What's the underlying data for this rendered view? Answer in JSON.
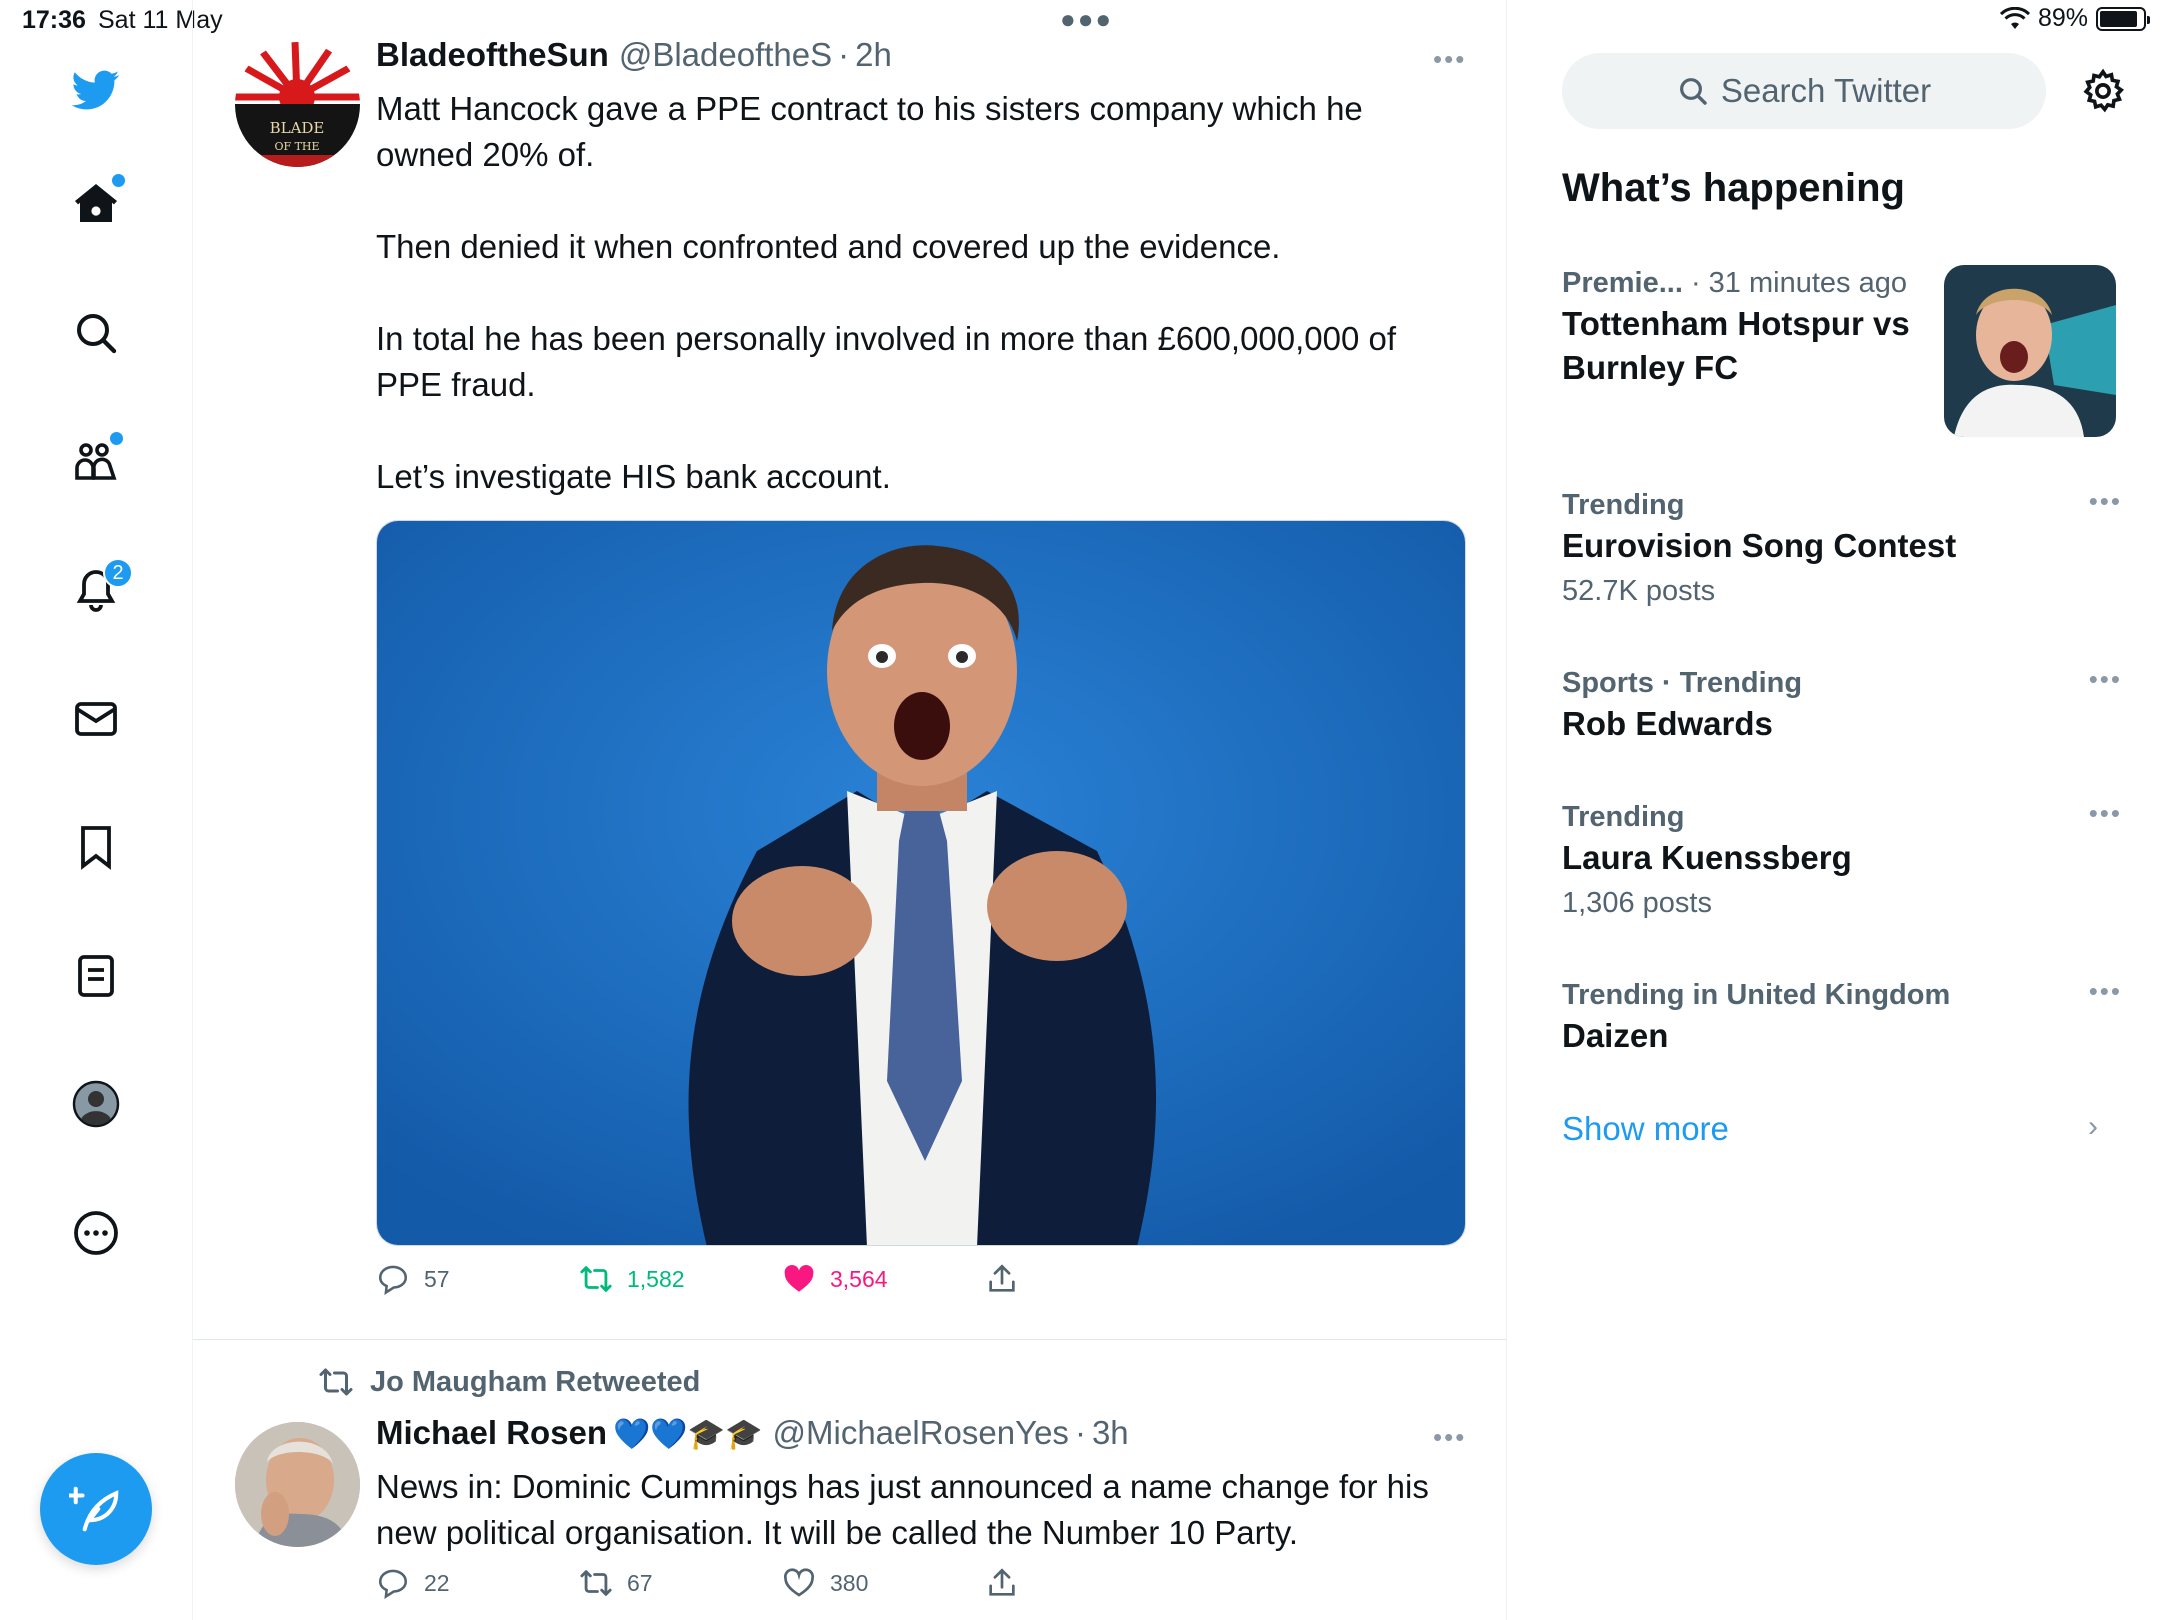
{
  "status": {
    "time": "17:36",
    "date": "Sat 11 May",
    "battery": "89%",
    "battery_level": 0.89
  },
  "nav": {
    "notifications_badge": "2"
  },
  "tweets": [
    {
      "name": "BladeoftheSun",
      "handle": "@BladeoftheS",
      "sep": "·",
      "time": "2h",
      "paragraphs": [
        "Matt Hancock gave a PPE contract to his sisters company which he owned 20% of.",
        "Then denied it when confronted and covered up the evidence.",
        "In total he has been personally involved in more than £600,000,000 of PPE fraud.",
        "Let’s investigate HIS bank account."
      ],
      "avatar_text": "BLADE OF THE SUN",
      "replies": "57",
      "retweets": "1,582",
      "likes": "3,564"
    },
    {
      "retweeted_by": "Jo Maugham Retweeted",
      "name": "Michael Rosen",
      "emojis": "💙💙🎓🎓",
      "handle": "@MichaelRosenYes",
      "sep": "·",
      "time": "3h",
      "text": "News in: Dominic Cummings has just announced a name change for his new political organisation. It will be called the Number 10 Party.",
      "replies": "22",
      "retweets": "67",
      "likes": "380"
    }
  ],
  "sidebar": {
    "search_placeholder": "Search Twitter",
    "section_title": "What’s happening",
    "trends": [
      {
        "category": "Premie...",
        "time": "· 31 minutes ago",
        "name": "Tottenham Hotspur vs Burnley FC"
      },
      {
        "category": "Trending",
        "name": "Eurovision Song Contest",
        "count": "52.7K posts"
      },
      {
        "category": "Sports · Trending",
        "name": "Rob Edwards"
      },
      {
        "category": "Trending",
        "name": "Laura Kuenssberg",
        "count": "1,306 posts"
      },
      {
        "category": "Trending in United Kingdom",
        "name": "Daizen"
      }
    ],
    "show_more": "Show more"
  },
  "colors": {
    "accent": "#1d9bf0",
    "retweet_active": "#00ba7c",
    "like_active": "#f91880",
    "media_background": "#1d6fc7"
  }
}
